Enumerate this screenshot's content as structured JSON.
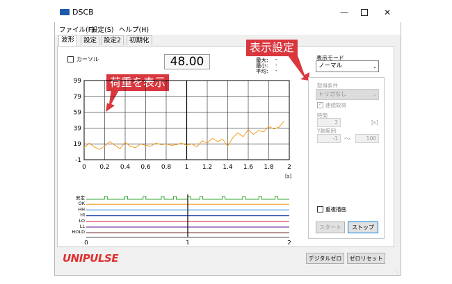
{
  "window": {
    "title": "DSCB",
    "min_icon": "minimize-icon",
    "max_icon": "maximize-icon",
    "close_icon": "close-icon"
  },
  "menu": [
    "ファイル(F)",
    "設定(S)",
    "ヘルプ(H)"
  ],
  "tabs": [
    "波形",
    "設定",
    "設定2",
    "初期化"
  ],
  "cursor_label": "カーソル",
  "value_display": "48.00",
  "stats": {
    "max_label": "最大:",
    "min_label": "最小:",
    "avg_label": "平均:",
    "max": "-",
    "min": "-",
    "avg": "-"
  },
  "callouts": {
    "display_settings": "表示設定",
    "load_display": "荷重を表示"
  },
  "display_mode": {
    "label": "表示モード",
    "value": "ノーマル"
  },
  "acquisition": {
    "condition_label": "取得条件",
    "condition_value": "トリガなし",
    "continuous_label": "連続取得",
    "time_label": "時間",
    "time_value": "2",
    "time_unit": "[s]",
    "y_range_label": "Y軸範囲",
    "y_min": "-1",
    "y_sep": "〜",
    "y_max": "100",
    "overlay_label": "重複描画",
    "start_label": "スタート",
    "stop_label": "ストップ"
  },
  "footer": {
    "logo": "UNIPULSE",
    "digital_zero": "デジタルゼロ",
    "zero_reset": "ゼロリセット"
  },
  "chart_data": {
    "type": "line",
    "x_unit": "[s]",
    "xlim": [
      0,
      2
    ],
    "ylim": [
      -1,
      99
    ],
    "x_ticks": [
      "0",
      "0.2",
      "0.4",
      "0.6",
      "0.8",
      "1",
      "1.2",
      "1.4",
      "1.6",
      "1.8",
      "2"
    ],
    "y_ticks": [
      "99",
      "79",
      "59",
      "39",
      "19",
      "-1"
    ],
    "grid": true,
    "color": "#f4a020",
    "x": [
      0,
      0.05,
      0.1,
      0.15,
      0.2,
      0.25,
      0.3,
      0.35,
      0.4,
      0.45,
      0.5,
      0.55,
      0.6,
      0.65,
      0.7,
      0.75,
      0.8,
      0.85,
      0.9,
      0.95,
      1.0,
      1.05,
      1.1,
      1.15,
      1.2,
      1.25,
      1.3,
      1.35,
      1.4,
      1.45,
      1.5,
      1.55,
      1.6,
      1.65,
      1.7,
      1.75,
      1.8,
      1.85,
      1.9,
      1.95
    ],
    "y": [
      14,
      20,
      15,
      12,
      16,
      22,
      17,
      13,
      21,
      16,
      14,
      19,
      17,
      16,
      20,
      18,
      19,
      17,
      18,
      20,
      17,
      19,
      15,
      23,
      20,
      26,
      22,
      25,
      16,
      27,
      33,
      28,
      37,
      31,
      36,
      34,
      41,
      38,
      40,
      48
    ]
  },
  "digital_chart": {
    "signals": [
      "安定",
      "OK",
      "HH",
      "HI",
      "LO",
      "LL",
      "HOLD"
    ],
    "colors": [
      "#2fa52f",
      "#f4a020",
      "#3a9ad9",
      "#2a4fb0",
      "#d9363e",
      "#7a3fa8",
      "#6b2c2c"
    ],
    "x_ticks": [
      "0",
      "1",
      "2"
    ],
    "pulses": [
      0.18,
      0.38,
      0.56,
      0.74,
      0.86,
      1.0,
      1.12,
      1.34,
      1.54,
      1.7,
      1.86
    ]
  }
}
